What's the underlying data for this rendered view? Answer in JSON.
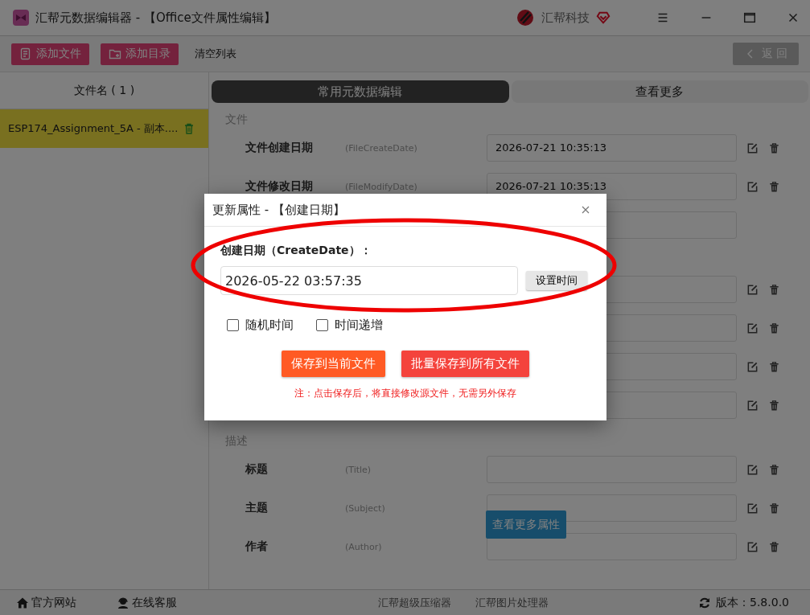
{
  "window": {
    "title": "汇帮元数据编辑器 - 【Office文件属性编辑】",
    "brand": "汇帮科技"
  },
  "toolbar": {
    "buttons": [
      {
        "label": "添加文件",
        "kind": "file"
      },
      {
        "label": "添加目录",
        "kind": "folder"
      }
    ],
    "clear": "清空列表",
    "back": "返 回"
  },
  "file_list": {
    "header": "文件名 ( 1 )",
    "items": [
      {
        "name": "ESP174_Assignment_5A - 副本....",
        "selected": true
      }
    ]
  },
  "tabs": [
    {
      "label": "常用元数据编辑",
      "selected": true
    },
    {
      "label": "查看更多",
      "selected": false
    }
  ],
  "sections": [
    {
      "title": "文件",
      "rows": [
        {
          "label": "文件创建日期",
          "hint": "(FileCreateDate)",
          "value": "2026-07-21 10:35:13",
          "actions": true
        },
        {
          "label": "文件修改日期",
          "hint": "(FileModifyDate)",
          "value": "2026-07-21 10:35:13",
          "actions": true
        },
        {
          "actions": false
        }
      ]
    },
    {
      "rows": [
        {
          "actions": true
        },
        {
          "actions": true
        },
        {
          "actions": true
        },
        {
          "actions": true
        }
      ]
    },
    {
      "title": "描述",
      "rows": [
        {
          "label": "标题",
          "hint": "(Title)",
          "actions": true
        },
        {
          "label": "主题",
          "hint": "(Subject)",
          "actions": true
        },
        {
          "label": "作者",
          "hint": "(Author)",
          "actions": true
        }
      ]
    }
  ],
  "more_button": "查看更多属性",
  "dialog": {
    "title": "更新属性 - 【创建日期】",
    "label": "创建日期（CreateDate）：",
    "value": "2026-05-22 03:57:35",
    "set_time": "设置时间",
    "checkboxes": [
      {
        "label": "随机时间",
        "checked": false
      },
      {
        "label": "时间递增",
        "checked": false
      }
    ],
    "buttons": [
      {
        "label": "保存到当前文件",
        "kind": "current"
      },
      {
        "label": "批量保存到所有文件",
        "kind": "all"
      }
    ],
    "note": "注：点击保存后，将直接修改源文件，无需另外保存"
  },
  "footer": {
    "left": [
      {
        "label": "官方网站",
        "kind": "home"
      },
      {
        "label": "在线客服",
        "kind": "support"
      }
    ],
    "center": [
      "汇帮超级压缩器",
      "汇帮图片处理器"
    ],
    "version": "版本：5.8.0.0"
  }
}
